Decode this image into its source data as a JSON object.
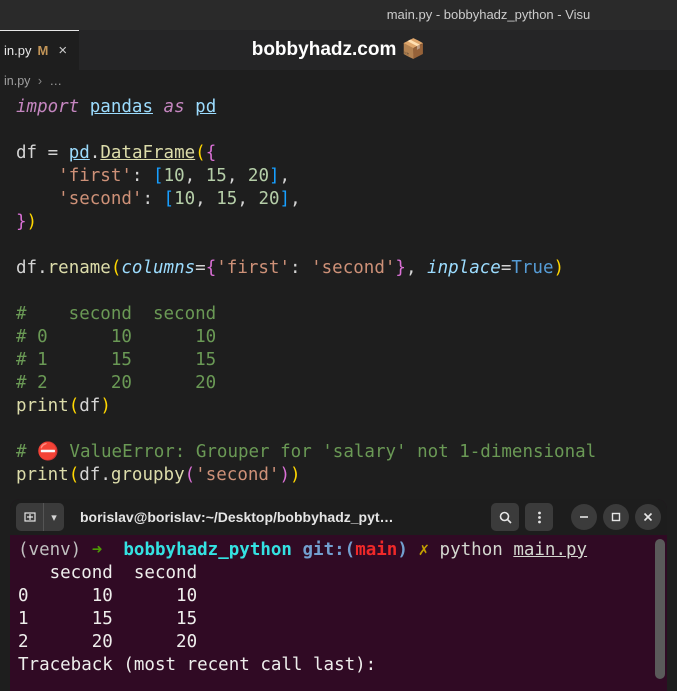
{
  "window": {
    "title": "main.py - bobbyhadz_python - Visu"
  },
  "tab": {
    "name": "in.py",
    "modified_marker": "M",
    "close": "×"
  },
  "watermark": {
    "text": "bobbyhadz.com 📦"
  },
  "breadcrumb": {
    "file": "in.py",
    "sep": "›",
    "rest": "…"
  },
  "code": {
    "l1": {
      "import": "import",
      "pandas": "pandas",
      "as": "as",
      "pd": "pd"
    },
    "l3": {
      "df": "df",
      "eq": "=",
      "pd": "pd",
      "dot": ".",
      "DataFrame": "DataFrame",
      "op": "(",
      "brace": "{"
    },
    "l4": {
      "k": "'first'",
      "colon": ":",
      "ob": "[",
      "n1": "10",
      "c": ",",
      "n2": "15",
      "n3": "20",
      "cb": "]",
      "tc": ","
    },
    "l5": {
      "k": "'second'",
      "colon": ":",
      "ob": "[",
      "n1": "10",
      "c": ",",
      "n2": "15",
      "n3": "20",
      "cb": "]",
      "tc": ","
    },
    "l6": {
      "brace": "}",
      "cp": ")"
    },
    "l8": {
      "df": "df",
      "dot": ".",
      "rename": "rename",
      "op": "(",
      "columns": "columns",
      "eq": "=",
      "ob": "{",
      "k1": "'first'",
      "colon": ":",
      "k2": "'second'",
      "cb": "}",
      "c": ",",
      "inplace": "inplace",
      "eq2": "=",
      "true": "True",
      "cp": ")"
    },
    "c1": "#    second  second",
    "c2": "# 0      10      10",
    "c3": "# 1      15      15",
    "c4": "# 2      20      20",
    "l14": {
      "print": "print",
      "op": "(",
      "df": "df",
      "cp": ")"
    },
    "c5a": "# ",
    "c5b": " ValueError: Grouper for 'salary' not 1-dimensional",
    "l17": {
      "print": "print",
      "op": "(",
      "df": "df",
      "dot": ".",
      "groupby": "groupby",
      "op2": "(",
      "arg": "'second'",
      "cp2": ")",
      "cp": ")"
    }
  },
  "terminal": {
    "title": "borislav@borislav:~/Desktop/bobbyhadz_pyt…",
    "prompt": {
      "venv": "(venv)",
      "arrow": "➜",
      "proj": "bobbyhadz_python",
      "git": "git:(",
      "branch": "main",
      "gitc": ")",
      "x": "✗",
      "cmd": "python",
      "file": "main.py"
    },
    "out1": "   second  second",
    "out2": "0      10      10",
    "out3": "1      15      15",
    "out4": "2      20      20",
    "out5": "Traceback (most recent call last):"
  }
}
